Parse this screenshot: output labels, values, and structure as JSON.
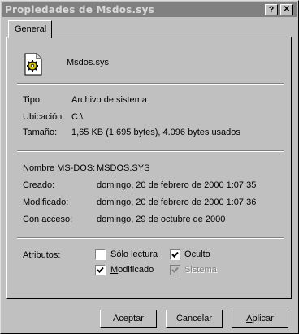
{
  "window": {
    "title": "Propiedades de Msdos.sys",
    "help_glyph": "?",
    "close_glyph": "✕"
  },
  "tabs": [
    {
      "label": "General"
    }
  ],
  "file": {
    "name": "Msdos.sys",
    "icon": "system-file-gear-icon"
  },
  "info": {
    "tipo_label": "Tipo:",
    "tipo_value": "Archivo de sistema",
    "ubicacion_label": "Ubicación:",
    "ubicacion_value": "C:\\",
    "tamano_label": "Tamaño:",
    "tamano_value": "1,65 KB (1.695 bytes), 4.096 bytes usados"
  },
  "details": {
    "msdos_label": "Nombre MS-DOS:",
    "msdos_value": "MSDOS.SYS",
    "creado_label": "Creado:",
    "creado_value": "domingo, 20 de febrero de 2000 1:07:35",
    "modificado_label": "Modificado:",
    "modificado_value": "domingo, 20 de febrero de 2000 1:07:36",
    "acceso_label": "Con acceso:",
    "acceso_value": "domingo, 29 de octubre de 2000"
  },
  "attributes": {
    "label": "Atributos:",
    "solo_lectura": {
      "hotkey": "S",
      "rest": "ólo lectura",
      "checked": false,
      "enabled": true
    },
    "oculto": {
      "hotkey": "O",
      "rest": "culto",
      "checked": true,
      "enabled": true
    },
    "modificado": {
      "hotkey": "M",
      "rest": "odificado",
      "checked": true,
      "enabled": true
    },
    "sistema": {
      "label": "Sistema",
      "checked": true,
      "enabled": false
    }
  },
  "buttons": {
    "aceptar": "Aceptar",
    "cancelar": "Cancelar",
    "aplicar_hotkey": "A",
    "aplicar_rest": "plicar"
  },
  "colors": {
    "face": "#c0c0c0",
    "titlebar_inactive": "#808080",
    "disabled_text": "#808080"
  }
}
